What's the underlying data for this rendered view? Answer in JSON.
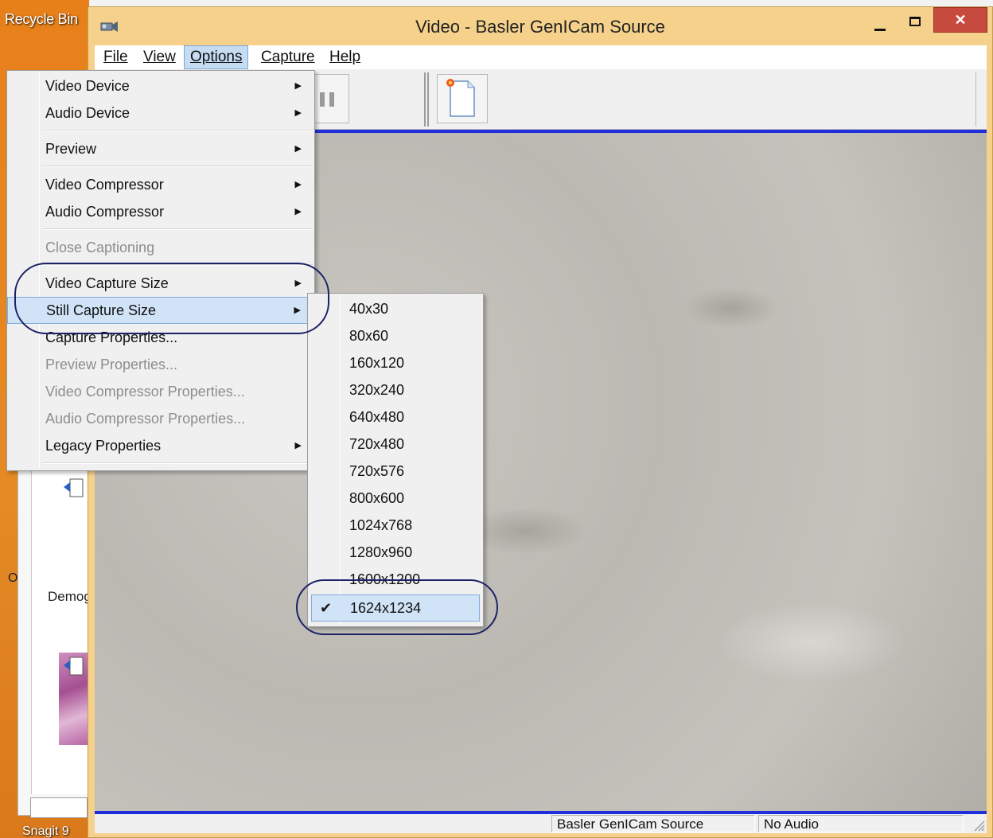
{
  "desktop": {
    "recycle_bin": "Recycle Bin",
    "back_o": "O",
    "back_demo": "Demog",
    "back_snag": "Snagit 9"
  },
  "window": {
    "title": "Video - Basler GenICam Source",
    "close_glyph": "✕"
  },
  "menubar": {
    "items": [
      "File",
      "View",
      "Options",
      "Capture",
      "Help"
    ],
    "active": "Options"
  },
  "options_menu": {
    "items": [
      {
        "label": "Video Device",
        "submenu": true,
        "disabled": false
      },
      {
        "label": "Audio Device",
        "submenu": true,
        "disabled": false
      },
      {
        "label": "Preview",
        "submenu": true,
        "disabled": false
      },
      {
        "label": "Video Compressor",
        "submenu": true,
        "disabled": false
      },
      {
        "label": "Audio Compressor",
        "submenu": true,
        "disabled": false
      },
      {
        "label": "Close Captioning",
        "submenu": false,
        "disabled": true
      },
      {
        "label": "Video Capture Size",
        "submenu": true,
        "disabled": false
      },
      {
        "label": "Still Capture Size",
        "submenu": true,
        "disabled": false,
        "highlighted": true
      },
      {
        "label": "Capture Properties...",
        "submenu": false,
        "disabled": false
      },
      {
        "label": "Preview Properties...",
        "submenu": false,
        "disabled": true
      },
      {
        "label": "Video Compressor Properties...",
        "submenu": false,
        "disabled": true
      },
      {
        "label": "Audio Compressor Properties...",
        "submenu": false,
        "disabled": true
      },
      {
        "label": "Legacy Properties",
        "submenu": true,
        "disabled": false
      }
    ],
    "arrow_glyph": "▶"
  },
  "still_capture_submenu": {
    "items": [
      "40x30",
      "80x60",
      "160x120",
      "320x240",
      "640x480",
      "720x480",
      "720x576",
      "800x600",
      "1024x768",
      "1280x960",
      "1600x1200",
      "1624x1234"
    ],
    "selected": "1624x1234",
    "check_glyph": "✔"
  },
  "statusbar": {
    "source": "Basler GenICam Source",
    "audio": "No Audio"
  },
  "colors": {
    "title_bar": "#f5d18b",
    "close_button": "#c74a3f",
    "video_border": "#1f2fd9",
    "annotation": "#1c2266",
    "highlight": "#d1e3f6"
  }
}
